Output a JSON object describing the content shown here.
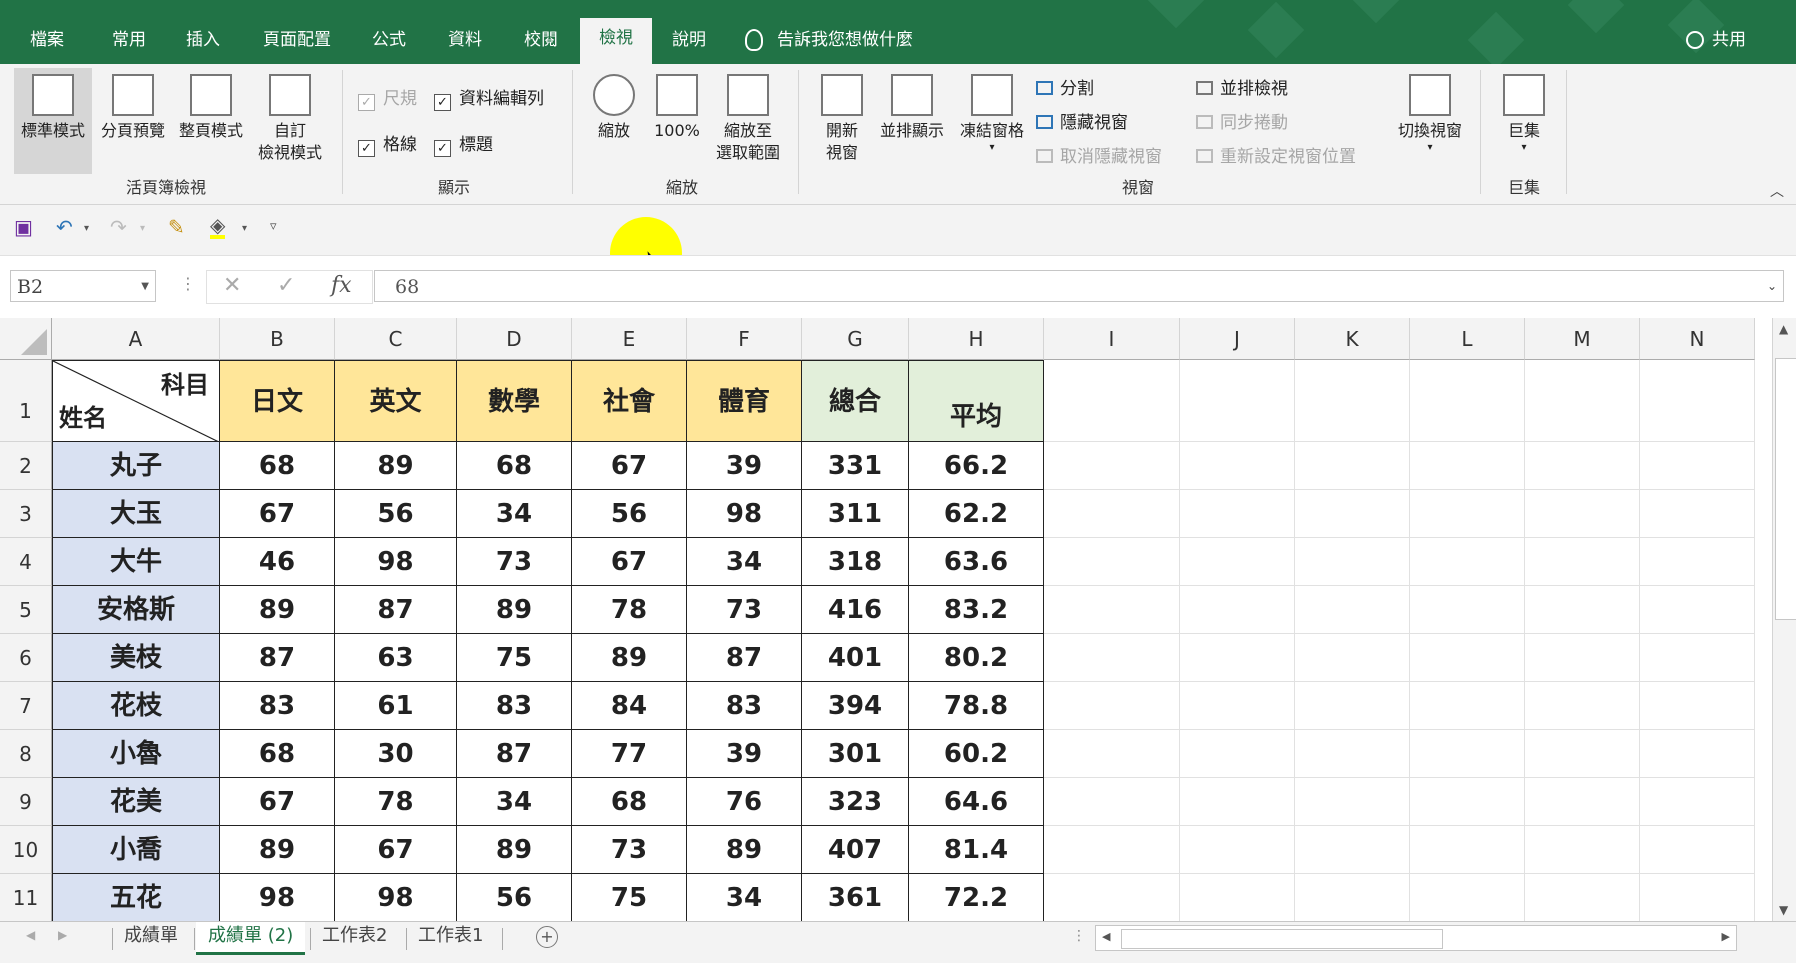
{
  "menu": {
    "tabs": [
      "檔案",
      "常用",
      "插入",
      "頁面配置",
      "公式",
      "資料",
      "校閱",
      "檢視",
      "說明"
    ],
    "active_tab": "檢視",
    "tellme": "告訴我您想做什麼",
    "share": "共用"
  },
  "ribbon": {
    "workbook_views": {
      "label": "活頁簿檢視",
      "normal": "標準模式",
      "page_break": "分頁預覽",
      "page_layout": "整頁模式",
      "custom_1": "自訂",
      "custom_2": "檢視模式"
    },
    "show": {
      "label": "顯示",
      "ruler": "尺規",
      "formula_bar": "資料編輯列",
      "gridlines": "格線",
      "headings": "標題"
    },
    "zoom": {
      "label": "縮放",
      "zoom": "縮放",
      "hundred": "100%",
      "to_sel_1": "縮放至",
      "to_sel_2": "選取範圍"
    },
    "window": {
      "label": "視窗",
      "new_1": "開新",
      "new_2": "視窗",
      "arrange": "並排顯示",
      "freeze": "凍結窗格",
      "split": "分割",
      "hide": "隱藏視窗",
      "unhide": "取消隱藏視窗",
      "side_by_side": "並排檢視",
      "sync_scroll": "同步捲動",
      "reset_pos": "重新設定視窗位置",
      "switch": "切換視窗"
    },
    "macros": {
      "label": "巨集",
      "macros": "巨集"
    }
  },
  "formula_bar": {
    "name_box": "B2",
    "value": "68"
  },
  "columns": [
    "A",
    "B",
    "C",
    "D",
    "E",
    "F",
    "G",
    "H",
    "I",
    "J",
    "K",
    "L",
    "M",
    "N"
  ],
  "header_row": {
    "corner_top": "科目",
    "corner_bottom": "姓名",
    "subjects": [
      "日文",
      "英文",
      "數學",
      "社會",
      "體育",
      "總合",
      "平均"
    ]
  },
  "rows": [
    {
      "num": "2",
      "name": "丸子",
      "vals": [
        "68",
        "89",
        "68",
        "67",
        "39",
        "331",
        "66.2"
      ]
    },
    {
      "num": "3",
      "name": "大玉",
      "vals": [
        "67",
        "56",
        "34",
        "56",
        "98",
        "311",
        "62.2"
      ]
    },
    {
      "num": "4",
      "name": "大牛",
      "vals": [
        "46",
        "98",
        "73",
        "67",
        "34",
        "318",
        "63.6"
      ]
    },
    {
      "num": "5",
      "name": "安格斯",
      "vals": [
        "89",
        "87",
        "89",
        "78",
        "73",
        "416",
        "83.2"
      ]
    },
    {
      "num": "6",
      "name": "美枝",
      "vals": [
        "87",
        "63",
        "75",
        "89",
        "87",
        "401",
        "80.2"
      ]
    },
    {
      "num": "7",
      "name": "花枝",
      "vals": [
        "83",
        "61",
        "83",
        "84",
        "83",
        "394",
        "78.8"
      ]
    },
    {
      "num": "8",
      "name": "小魯",
      "vals": [
        "68",
        "30",
        "87",
        "77",
        "39",
        "301",
        "60.2"
      ]
    },
    {
      "num": "9",
      "name": "花美",
      "vals": [
        "67",
        "78",
        "34",
        "68",
        "76",
        "323",
        "64.6"
      ]
    },
    {
      "num": "10",
      "name": "小喬",
      "vals": [
        "89",
        "67",
        "89",
        "73",
        "89",
        "407",
        "81.4"
      ]
    },
    {
      "num": "11",
      "name": "五花",
      "vals": [
        "98",
        "98",
        "56",
        "75",
        "34",
        "361",
        "72.2"
      ]
    }
  ],
  "sheets": [
    "成績單",
    "成績單 (2)",
    "工作表2",
    "工作表1"
  ],
  "active_sheet": "成績單 (2)",
  "icons": [
    "save-icon",
    "undo-icon",
    "redo-icon",
    "format-painter-icon",
    "fill-color-icon",
    "customize-qat-icon",
    "cancel-icon",
    "enter-icon",
    "function-icon",
    "new-sheet-icon"
  ],
  "colors": {
    "excel_green": "#217346",
    "header_fill": "#ffe699",
    "total_fill": "#e2efda",
    "name_fill": "#d9e1f2"
  }
}
